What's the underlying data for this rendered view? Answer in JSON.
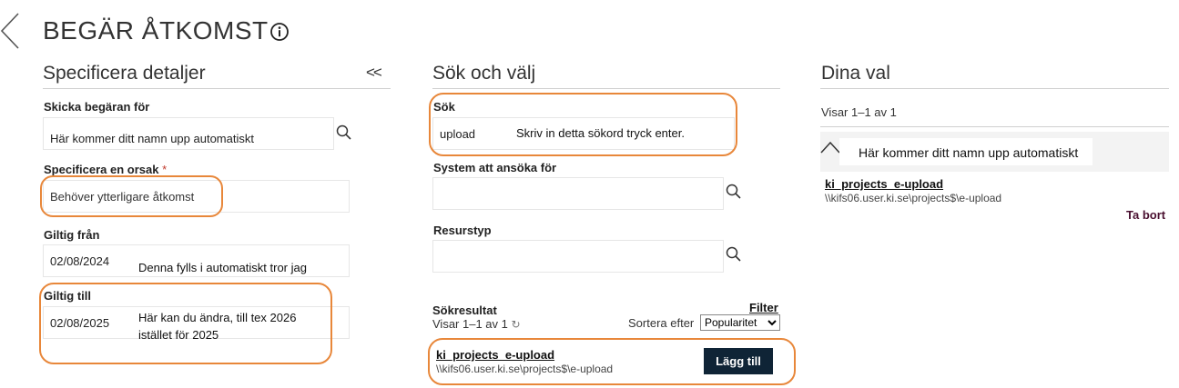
{
  "page": {
    "title": "BEGÄR ÅTKOMST"
  },
  "details": {
    "title": "Specificera detaljer",
    "collapse": "<<",
    "request_for_label": "Skicka begäran för",
    "request_for_value": "Här kommer ditt namn upp automatiskt",
    "reason_label": "Specificera en orsak",
    "reason_required": "*",
    "reason_value": "Behöver ytterligare åtkomst",
    "valid_from_label": "Giltig från",
    "valid_from_value": "02/08/2024",
    "valid_from_note": "Denna fylls i automatiskt tror jag",
    "valid_to_label": "Giltig till",
    "valid_to_value": "02/08/2025",
    "valid_to_note": "Här kan du ändra, till tex 2026 istället för 2025"
  },
  "search": {
    "title": "Sök och välj",
    "search_label": "Sök",
    "search_value": "upload",
    "search_note": "Skriv in detta sökord tryck enter.",
    "system_label": "System att ansöka för",
    "resource_label": "Resurstyp",
    "results_label": "Sökresultat",
    "filter_label": "Filter",
    "showing": "Visar 1–1 av 1",
    "refresh_icon": "↻",
    "sort_label": "Sortera efter",
    "sort_value": "Popularitet",
    "result": {
      "name": "ki_projects_e-upload",
      "path": "\\\\kifs06.user.ki.se\\projects$\\e-upload",
      "add_label": "Lägg till"
    }
  },
  "choices": {
    "title": "Dina val",
    "showing": "Visar 1–1 av 1",
    "user_name": "Här kommer ditt namn upp automatiskt",
    "item": {
      "name": "ki_projects_e-upload",
      "path": "\\\\kifs06.user.ki.se\\projects$\\e-upload",
      "remove_label": "Ta bort"
    }
  },
  "colors": {
    "annotation": "#e8873a",
    "button_bg": "#0f2436",
    "remove_text": "#4a1030"
  },
  "icons": [
    "back-arrow-icon",
    "info-icon",
    "search-icon",
    "refresh-icon",
    "chevron-up-icon"
  ]
}
